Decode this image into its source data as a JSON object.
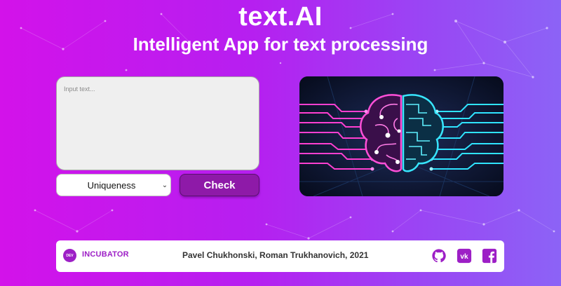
{
  "header": {
    "title": "text.AI",
    "subtitle": "Intelligent App for text processing"
  },
  "form": {
    "input_placeholder": "Input text...",
    "mode_select_value": "Uniqueness",
    "check_label": "Check"
  },
  "illustration": {
    "name": "ai-brain-circuit-illustration"
  },
  "footer": {
    "logo_text": "DEV",
    "brand": "INCUBATOR",
    "credits": "Pavel Chukhonski, Roman Trukhanovich, 2021",
    "social_icons": [
      "github-icon",
      "vk-icon",
      "facebook-icon"
    ]
  },
  "colors": {
    "background_start": "#d312ea",
    "background_end": "#8c63f6",
    "accent": "#9d1fc6",
    "button": "#8e1aa8"
  }
}
